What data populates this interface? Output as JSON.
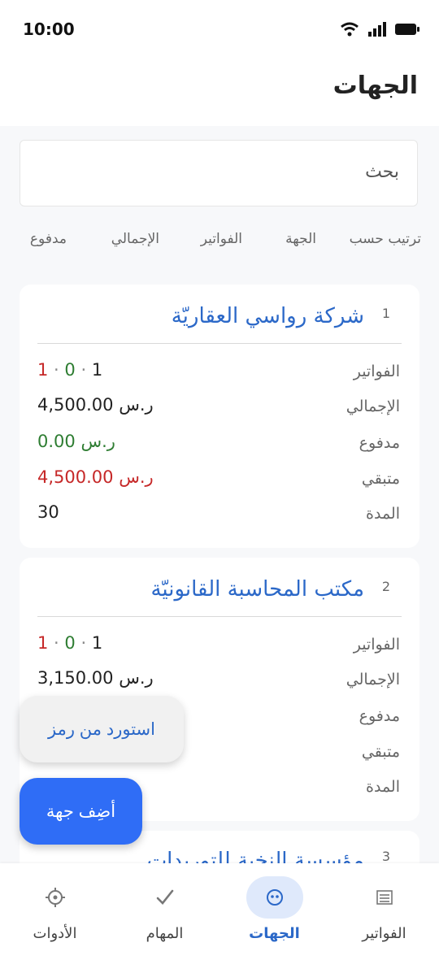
{
  "status": {
    "time": "10:00"
  },
  "header": {
    "title": "الجهات"
  },
  "search": {
    "placeholder": "بحث"
  },
  "sort": {
    "label": "ترتيب حسب",
    "options": [
      "الجهة",
      "الفواتير",
      "الإجمالي",
      "مدفوع"
    ]
  },
  "row_labels": {
    "invoices": "الفواتير",
    "total": "الإجمالي",
    "paid": "مدفوع",
    "remaining": "متبقي",
    "duration": "المدة"
  },
  "currency": "ر.س",
  "cards": [
    {
      "index": "1",
      "name": "شركة رواسي العقاريّة",
      "invoices": {
        "total": "1",
        "paid": "0",
        "unpaid": "1"
      },
      "total": "4,500.00",
      "paid": "0.00",
      "remaining": "4,500.00",
      "duration": "30"
    },
    {
      "index": "2",
      "name": "مكتب المحاسبة القانونيّة",
      "invoices": {
        "total": "1",
        "paid": "0",
        "unpaid": "1"
      },
      "total": "3,150.00",
      "duration": ""
    },
    {
      "index": "3",
      "name": "مؤسسة النخبة للتوريدات"
    }
  ],
  "fab": {
    "import_label": "استورد من رمز",
    "add_label": "أضِف جهة"
  },
  "nav": [
    {
      "label": "الفواتير",
      "icon": "invoices-icon"
    },
    {
      "label": "الجهات",
      "icon": "contacts-icon"
    },
    {
      "label": "المهام",
      "icon": "tasks-icon"
    },
    {
      "label": "الأدوات",
      "icon": "tools-icon"
    }
  ],
  "colors": {
    "accent": "#2f6df6",
    "title_blue": "#2b68c8",
    "green": "#2e7d32",
    "red": "#c62828"
  }
}
